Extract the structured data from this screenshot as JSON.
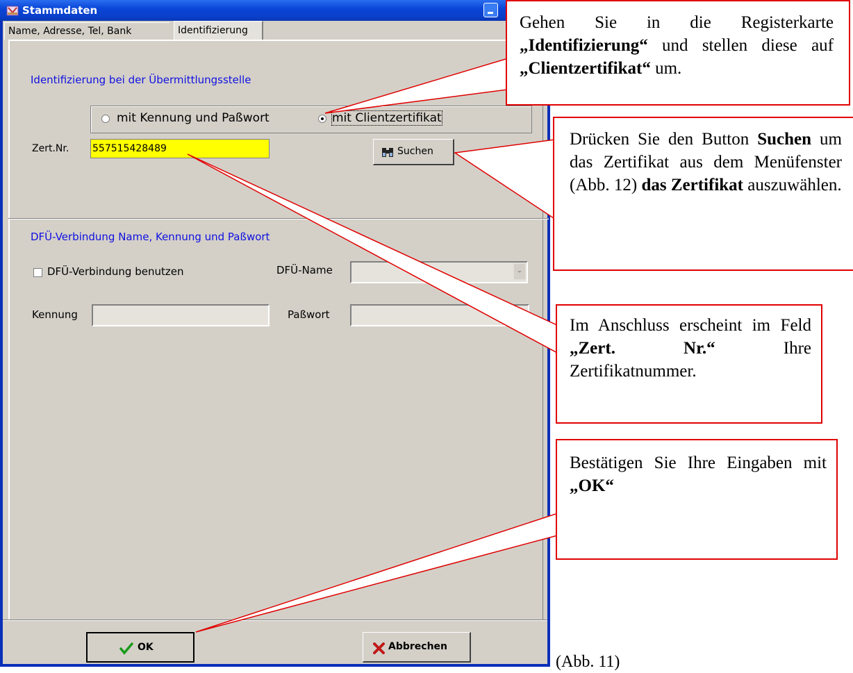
{
  "window": {
    "title": "Stammdaten",
    "tabs": [
      {
        "label": "Name, Adresse, Tel, Bank"
      },
      {
        "label": "Identifizierung"
      }
    ],
    "identification": {
      "heading": "Identifizierung bei der Übermittlungsstelle",
      "radio_password": "mit Kennung und Paßwort",
      "radio_certificate": "mit Clientzertifikat",
      "selected": "mit Clientzertifikat",
      "cert_label": "Zert.Nr.",
      "cert_value": "557515428489",
      "search_button": "Suchen"
    },
    "dialup": {
      "heading": "DFÜ-Verbindung Name, Kennung und Paßwort",
      "checkbox_label": "DFÜ-Verbindung benutzen",
      "name_label": "DFÜ-Name",
      "name_value": "",
      "user_label": "Kennung",
      "user_value": "",
      "password_label": "Paßwort",
      "password_value": ""
    },
    "buttons": {
      "ok": "OK",
      "cancel": "Abbrechen"
    }
  },
  "callouts": {
    "tab": {
      "pre": "Gehen Sie in die Registerkarte ",
      "b1": "„Identifizierung“",
      "mid": " und stellen diese auf ",
      "b2": "„Clientzertifikat“",
      "post": " um."
    },
    "search": {
      "pre": "Drücken Sie den Button ",
      "b1": "Suchen",
      "mid": " um das Zertifikat aus dem Menüfenster (Abb. 12) ",
      "b2": "das Zertifikat",
      "post": " auszuwählen."
    },
    "cert": {
      "pre": "Im Anschluss erscheint im Feld ",
      "b1": "„Zert. Nr.“",
      "post": " Ihre Zertifikatnummer."
    },
    "ok": {
      "pre": "Bestätigen Sie Ihre Eingaben mit ",
      "b1": "„OK“"
    }
  },
  "caption": "(Abb. 11)",
  "colors": {
    "titlebar": "#0a46d8",
    "dialog_bg": "#d4d0c8",
    "field_highlight": "#ffff00",
    "callout_border": "#e00000",
    "label_blue": "#1010e0"
  },
  "icons": [
    "window-app-icon",
    "minimize-icon",
    "binoculars-icon",
    "checkmark-icon",
    "red-x-icon"
  ]
}
